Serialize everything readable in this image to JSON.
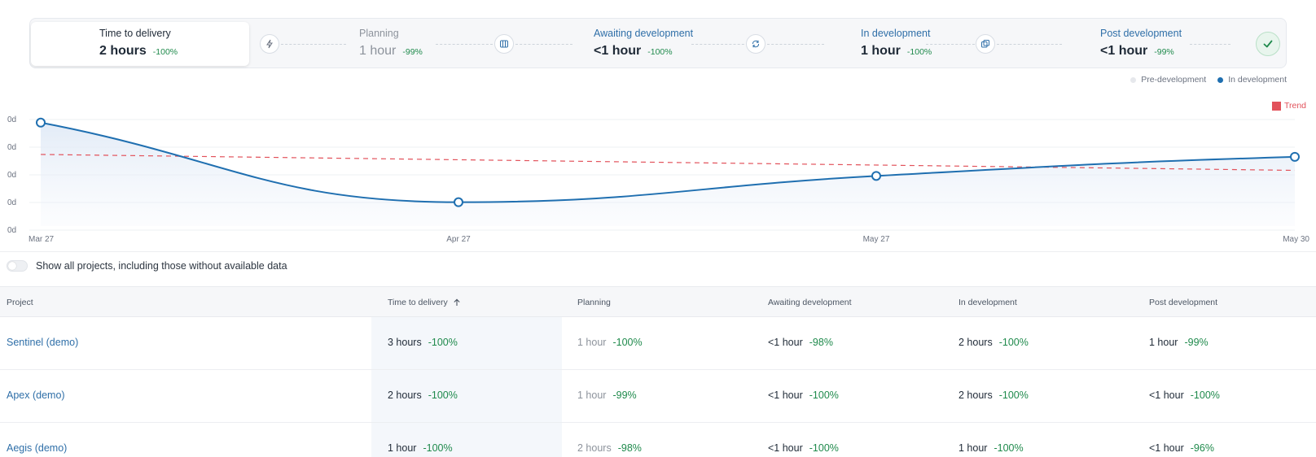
{
  "stages": [
    {
      "title": "Time to delivery",
      "value": "2 hours",
      "delta": "-100%",
      "style": "active",
      "icon": "none"
    },
    {
      "title": "Planning",
      "value": "1 hour",
      "delta": "-99%",
      "style": "muted",
      "icon": "lightning-icon"
    },
    {
      "title": "Awaiting development",
      "value": "<1 hour",
      "delta": "-100%",
      "style": "link",
      "icon": "columns-icon"
    },
    {
      "title": "In development",
      "value": "1 hour",
      "delta": "-100%",
      "style": "link",
      "icon": "refresh-icon"
    },
    {
      "title": "Post development",
      "value": "<1 hour",
      "delta": "-99%",
      "style": "link",
      "icon": "copy-icon"
    }
  ],
  "done_icon": "check-circle-icon",
  "legend": {
    "pre": "Pre-development",
    "in": "In development",
    "trend": "Trend"
  },
  "colors": {
    "line": "#1f6fb0",
    "trend": "#e2525b",
    "delta": "#1f8a4c",
    "link": "#2f6fa8",
    "pre_dot": "#e6e8ec"
  },
  "chart_data": {
    "type": "line",
    "x": [
      "Mar 27",
      "Apr 27",
      "May 27",
      "May 30"
    ],
    "y_tick_labels": [
      "0d",
      "0d",
      "0d",
      "0d",
      "0d"
    ],
    "series": [
      {
        "name": "In development",
        "values": [
          1.0,
          0.0,
          0.33,
          0.57
        ],
        "style": "solid-smooth-area"
      },
      {
        "name": "Trend",
        "values": [
          0.6,
          0.4
        ],
        "style": "dashed"
      }
    ],
    "ylim": [
      -0.3,
      1.1
    ],
    "grid": true
  },
  "toggle": {
    "label": "Show all projects, including those without available data",
    "on": false
  },
  "table": {
    "headers": [
      "Project",
      "Time to delivery",
      "Planning",
      "Awaiting development",
      "In development",
      "Post development"
    ],
    "sorted_column": 1,
    "rows": [
      {
        "project": "Sentinel (demo)",
        "cells": [
          {
            "v": "3 hours",
            "d": "-100%"
          },
          {
            "v": "1 hour",
            "d": "-100%",
            "muted": true
          },
          {
            "v": "<1 hour",
            "d": "-98%"
          },
          {
            "v": "2 hours",
            "d": "-100%"
          },
          {
            "v": "1 hour",
            "d": "-99%"
          }
        ]
      },
      {
        "project": "Apex (demo)",
        "cells": [
          {
            "v": "2 hours",
            "d": "-100%"
          },
          {
            "v": "1 hour",
            "d": "-99%",
            "muted": true
          },
          {
            "v": "<1 hour",
            "d": "-100%"
          },
          {
            "v": "2 hours",
            "d": "-100%"
          },
          {
            "v": "<1 hour",
            "d": "-100%"
          }
        ]
      },
      {
        "project": "Aegis (demo)",
        "cells": [
          {
            "v": "1 hour",
            "d": "-100%"
          },
          {
            "v": "2 hours",
            "d": "-98%",
            "muted": true
          },
          {
            "v": "<1 hour",
            "d": "-100%"
          },
          {
            "v": "1 hour",
            "d": "-100%"
          },
          {
            "v": "<1 hour",
            "d": "-96%"
          }
        ]
      }
    ]
  }
}
